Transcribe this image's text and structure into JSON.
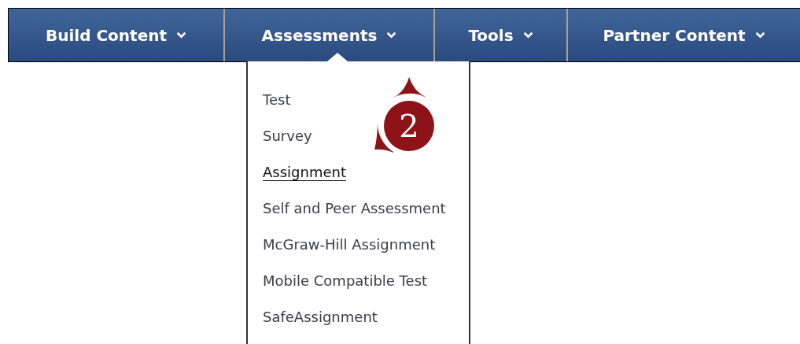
{
  "nav_tabs": [
    {
      "label": "Build Content",
      "expanded": false
    },
    {
      "label": "Assessments",
      "expanded": true
    },
    {
      "label": "Tools",
      "expanded": false
    },
    {
      "label": "Partner Content",
      "expanded": false
    }
  ],
  "dropdown": {
    "items": [
      {
        "label": "Test",
        "selected": false
      },
      {
        "label": "Survey",
        "selected": false
      },
      {
        "label": "Assignment",
        "selected": true
      },
      {
        "label": "Self and Peer Assessment",
        "selected": false
      },
      {
        "label": "McGraw-Hill Assignment",
        "selected": false
      },
      {
        "label": "Mobile Compatible Test",
        "selected": false
      },
      {
        "label": "SafeAssignment",
        "selected": false
      }
    ]
  },
  "step_badge": {
    "number": "2"
  }
}
